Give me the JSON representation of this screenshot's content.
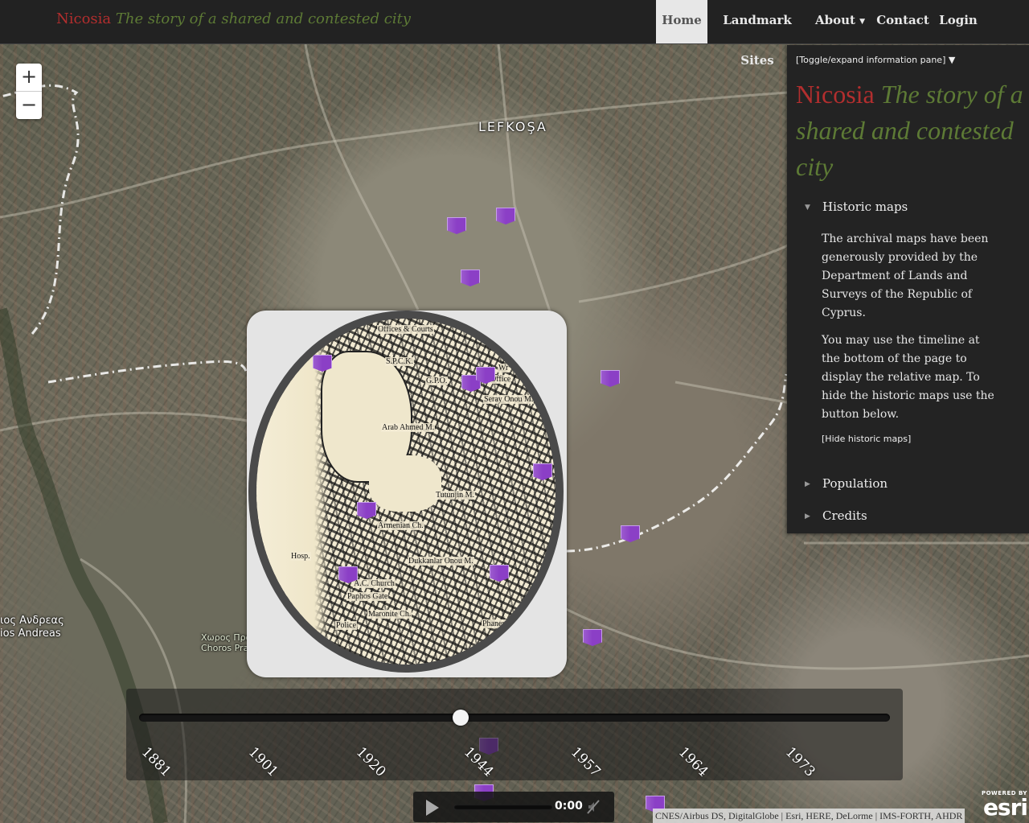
{
  "navbar": {
    "brand_city": "Nicosia",
    "brand_tagline": "The story of a shared and contested city",
    "items": [
      {
        "label": "Home",
        "active": true
      },
      {
        "label": "Landmark Sites"
      },
      {
        "label": "About",
        "has_caret": true
      },
      {
        "label": "Contact"
      },
      {
        "label": "Login"
      }
    ]
  },
  "map": {
    "zoom_in": "+",
    "zoom_out": "−",
    "labels": {
      "lefkosa": "LEFKOŞA",
      "andreas_1": "ιος Ανδρεας",
      "andreas_2": "ios Andreas",
      "choros_1": "Χωρος Πρα",
      "choros_2": "Choros Pra"
    },
    "historic_map_text": [
      "Offices & Courts",
      "S.P.C.K.",
      "G.P.O.",
      "Wr",
      "Office",
      "Seray Onou M.",
      "Arab Ahmed M.",
      "Tutunjin M.",
      "Armenian Ch.",
      "Dukkanlar Onou M.",
      "A.C. Church",
      "Paphos Gate",
      "Maronite Ch.",
      "Police",
      "Phaneromeni",
      "Hosp."
    ],
    "attribution": [
      "CNES/Airbus DS, DigitalGlobe",
      "Esri, HERE, DeLorme",
      "IMS-FORTH, AHDR"
    ],
    "esri_powered": "POWERED BY",
    "esri_logo": "esri"
  },
  "timeline": {
    "years": [
      "1881",
      "1901",
      "1920",
      "1944",
      "1957",
      "1964",
      "1973"
    ],
    "selected_year": "1944"
  },
  "player": {
    "time": "0:00",
    "progress": 0
  },
  "info_pane": {
    "toggle": "[Toggle/expand information pane] ▼",
    "title_city": "Nicosia",
    "title_tagline": "The story of a shared and contested city",
    "sections": {
      "historic_maps": {
        "label": "Historic maps",
        "expanded": true,
        "paragraphs": [
          "The archival maps have been generously provided by the Department of Lands and Surveys of the Republic of Cyprus.",
          "You may use the timeline at the bottom of the page to display the relative map. To hide the historic maps use the button below."
        ],
        "hide_link": "[Hide historic maps]"
      },
      "population": {
        "label": "Population",
        "expanded": false
      },
      "credits": {
        "label": "Credits",
        "expanded": false
      }
    }
  },
  "colors": {
    "brand_red": "#b22e2e",
    "brand_green": "#5d7a35",
    "marker": "#8b3fc6",
    "navbar": "#222222",
    "pane": "#232323"
  },
  "icons": {
    "section_expanded": "chevron-down-icon",
    "section_collapsed": "chevron-right-icon",
    "play": "play-icon",
    "mute": "mute-icon",
    "marker": "map-marker-icon"
  }
}
